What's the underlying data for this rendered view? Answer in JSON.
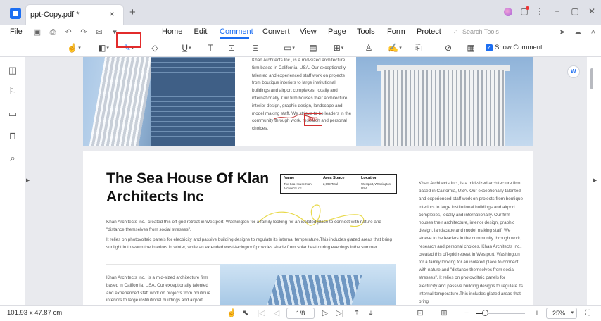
{
  "window": {
    "tab_title": "ppt-Copy.pdf *",
    "new_tab": "+",
    "close_tab": "×"
  },
  "menu": {
    "file": "File",
    "items": [
      "Home",
      "Edit",
      "Comment",
      "Convert",
      "View",
      "Page",
      "Tools",
      "Form",
      "Protect"
    ],
    "active": "Comment",
    "search_placeholder": "Search Tools"
  },
  "toolbar": {
    "show_comment_label": "Show Comment",
    "show_comment_checked": true,
    "selected_tool": "highlight"
  },
  "document": {
    "page1_text": "Khan Architects Inc., is a mid-sized architecture firm based in California, USA. Our exceptionally talented and experienced staff work on projects from boutique interiors to large institutional buildings and airport complexes, locally and internationally. Our firm houses their architecture, interior design, graphic design, landscape and model making staff. We strieve to be leaders in the community through work, research and personal choices.",
    "stamp_text": "test",
    "title": "The Sea House Of Klan Architects Inc",
    "info": [
      {
        "head": "Name",
        "value": "The Sea House Klan Architects Inc"
      },
      {
        "head": "Area Space",
        "value": "2,999 Total"
      },
      {
        "head": "Location",
        "value": "Westport, Washington, USA"
      }
    ],
    "intro": "Khan Architects Inc., created this off-grid retreat in Westport, Washington for a family looking for an isolated place to connect with nature and \"distance themselves from social stresses\".",
    "para": "It relies on photovoltaic panels for electricity and passive building designs to regulate its internal temperature.This includes glazed areas that bring sunlight in to warm the interiors in winter, while an extended west-facingroof provides shade from solar heat during evenings inthe summer.",
    "right_col": "Khan Architects Inc., is a mid-sized architecture firm based in California, USA. Our exceptionally talented and experienced staff work on projects from boutique interiors to large institutional buildings and airport complexes, locally and internationally. Our firm houses their architecture, interior design, graphic design, landscape and model making staff. We strieve to be leaders in the community through work, research and personal choices. Khan Architects Inc., created this off-grid retreat in Westport, Washington for a family looking for an isolated place to connect with nature and \"distance themselves from social stresses\". It relies on photovoltaic panels for electricity and passive building designs to regulate its internal temperature.This includes glazed areas that bring",
    "bottom_col": "Khan Architects Inc., is a mid-sized architecture firm based in California, USA. Our exceptionally talented and experienced staff work on projects from boutique interiors to large institutional buildings and airport complexes, locally and internationally."
  },
  "status": {
    "dimensions": "101.93 x 47.87 cm",
    "page_indicator": "1/8",
    "zoom": "25%",
    "zoom_level": 0.18
  },
  "colors": {
    "accent": "#1c6ef2",
    "highlight_box": "#e22b2b",
    "stamp": "#d03030",
    "ink": "#e8d94a"
  }
}
